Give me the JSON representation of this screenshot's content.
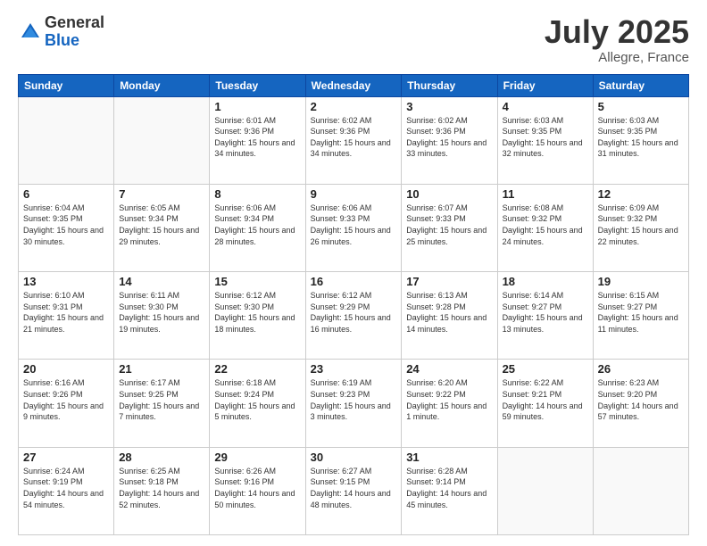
{
  "logo": {
    "general": "General",
    "blue": "Blue"
  },
  "title": {
    "month": "July 2025",
    "location": "Allegre, France"
  },
  "days_header": [
    "Sunday",
    "Monday",
    "Tuesday",
    "Wednesday",
    "Thursday",
    "Friday",
    "Saturday"
  ],
  "weeks": [
    [
      {
        "day": "",
        "sunrise": "",
        "sunset": "",
        "daylight": ""
      },
      {
        "day": "",
        "sunrise": "",
        "sunset": "",
        "daylight": ""
      },
      {
        "day": "1",
        "sunrise": "Sunrise: 6:01 AM",
        "sunset": "Sunset: 9:36 PM",
        "daylight": "Daylight: 15 hours and 34 minutes."
      },
      {
        "day": "2",
        "sunrise": "Sunrise: 6:02 AM",
        "sunset": "Sunset: 9:36 PM",
        "daylight": "Daylight: 15 hours and 34 minutes."
      },
      {
        "day": "3",
        "sunrise": "Sunrise: 6:02 AM",
        "sunset": "Sunset: 9:36 PM",
        "daylight": "Daylight: 15 hours and 33 minutes."
      },
      {
        "day": "4",
        "sunrise": "Sunrise: 6:03 AM",
        "sunset": "Sunset: 9:35 PM",
        "daylight": "Daylight: 15 hours and 32 minutes."
      },
      {
        "day": "5",
        "sunrise": "Sunrise: 6:03 AM",
        "sunset": "Sunset: 9:35 PM",
        "daylight": "Daylight: 15 hours and 31 minutes."
      }
    ],
    [
      {
        "day": "6",
        "sunrise": "Sunrise: 6:04 AM",
        "sunset": "Sunset: 9:35 PM",
        "daylight": "Daylight: 15 hours and 30 minutes."
      },
      {
        "day": "7",
        "sunrise": "Sunrise: 6:05 AM",
        "sunset": "Sunset: 9:34 PM",
        "daylight": "Daylight: 15 hours and 29 minutes."
      },
      {
        "day": "8",
        "sunrise": "Sunrise: 6:06 AM",
        "sunset": "Sunset: 9:34 PM",
        "daylight": "Daylight: 15 hours and 28 minutes."
      },
      {
        "day": "9",
        "sunrise": "Sunrise: 6:06 AM",
        "sunset": "Sunset: 9:33 PM",
        "daylight": "Daylight: 15 hours and 26 minutes."
      },
      {
        "day": "10",
        "sunrise": "Sunrise: 6:07 AM",
        "sunset": "Sunset: 9:33 PM",
        "daylight": "Daylight: 15 hours and 25 minutes."
      },
      {
        "day": "11",
        "sunrise": "Sunrise: 6:08 AM",
        "sunset": "Sunset: 9:32 PM",
        "daylight": "Daylight: 15 hours and 24 minutes."
      },
      {
        "day": "12",
        "sunrise": "Sunrise: 6:09 AM",
        "sunset": "Sunset: 9:32 PM",
        "daylight": "Daylight: 15 hours and 22 minutes."
      }
    ],
    [
      {
        "day": "13",
        "sunrise": "Sunrise: 6:10 AM",
        "sunset": "Sunset: 9:31 PM",
        "daylight": "Daylight: 15 hours and 21 minutes."
      },
      {
        "day": "14",
        "sunrise": "Sunrise: 6:11 AM",
        "sunset": "Sunset: 9:30 PM",
        "daylight": "Daylight: 15 hours and 19 minutes."
      },
      {
        "day": "15",
        "sunrise": "Sunrise: 6:12 AM",
        "sunset": "Sunset: 9:30 PM",
        "daylight": "Daylight: 15 hours and 18 minutes."
      },
      {
        "day": "16",
        "sunrise": "Sunrise: 6:12 AM",
        "sunset": "Sunset: 9:29 PM",
        "daylight": "Daylight: 15 hours and 16 minutes."
      },
      {
        "day": "17",
        "sunrise": "Sunrise: 6:13 AM",
        "sunset": "Sunset: 9:28 PM",
        "daylight": "Daylight: 15 hours and 14 minutes."
      },
      {
        "day": "18",
        "sunrise": "Sunrise: 6:14 AM",
        "sunset": "Sunset: 9:27 PM",
        "daylight": "Daylight: 15 hours and 13 minutes."
      },
      {
        "day": "19",
        "sunrise": "Sunrise: 6:15 AM",
        "sunset": "Sunset: 9:27 PM",
        "daylight": "Daylight: 15 hours and 11 minutes."
      }
    ],
    [
      {
        "day": "20",
        "sunrise": "Sunrise: 6:16 AM",
        "sunset": "Sunset: 9:26 PM",
        "daylight": "Daylight: 15 hours and 9 minutes."
      },
      {
        "day": "21",
        "sunrise": "Sunrise: 6:17 AM",
        "sunset": "Sunset: 9:25 PM",
        "daylight": "Daylight: 15 hours and 7 minutes."
      },
      {
        "day": "22",
        "sunrise": "Sunrise: 6:18 AM",
        "sunset": "Sunset: 9:24 PM",
        "daylight": "Daylight: 15 hours and 5 minutes."
      },
      {
        "day": "23",
        "sunrise": "Sunrise: 6:19 AM",
        "sunset": "Sunset: 9:23 PM",
        "daylight": "Daylight: 15 hours and 3 minutes."
      },
      {
        "day": "24",
        "sunrise": "Sunrise: 6:20 AM",
        "sunset": "Sunset: 9:22 PM",
        "daylight": "Daylight: 15 hours and 1 minute."
      },
      {
        "day": "25",
        "sunrise": "Sunrise: 6:22 AM",
        "sunset": "Sunset: 9:21 PM",
        "daylight": "Daylight: 14 hours and 59 minutes."
      },
      {
        "day": "26",
        "sunrise": "Sunrise: 6:23 AM",
        "sunset": "Sunset: 9:20 PM",
        "daylight": "Daylight: 14 hours and 57 minutes."
      }
    ],
    [
      {
        "day": "27",
        "sunrise": "Sunrise: 6:24 AM",
        "sunset": "Sunset: 9:19 PM",
        "daylight": "Daylight: 14 hours and 54 minutes."
      },
      {
        "day": "28",
        "sunrise": "Sunrise: 6:25 AM",
        "sunset": "Sunset: 9:18 PM",
        "daylight": "Daylight: 14 hours and 52 minutes."
      },
      {
        "day": "29",
        "sunrise": "Sunrise: 6:26 AM",
        "sunset": "Sunset: 9:16 PM",
        "daylight": "Daylight: 14 hours and 50 minutes."
      },
      {
        "day": "30",
        "sunrise": "Sunrise: 6:27 AM",
        "sunset": "Sunset: 9:15 PM",
        "daylight": "Daylight: 14 hours and 48 minutes."
      },
      {
        "day": "31",
        "sunrise": "Sunrise: 6:28 AM",
        "sunset": "Sunset: 9:14 PM",
        "daylight": "Daylight: 14 hours and 45 minutes."
      },
      {
        "day": "",
        "sunrise": "",
        "sunset": "",
        "daylight": ""
      },
      {
        "day": "",
        "sunrise": "",
        "sunset": "",
        "daylight": ""
      }
    ]
  ]
}
